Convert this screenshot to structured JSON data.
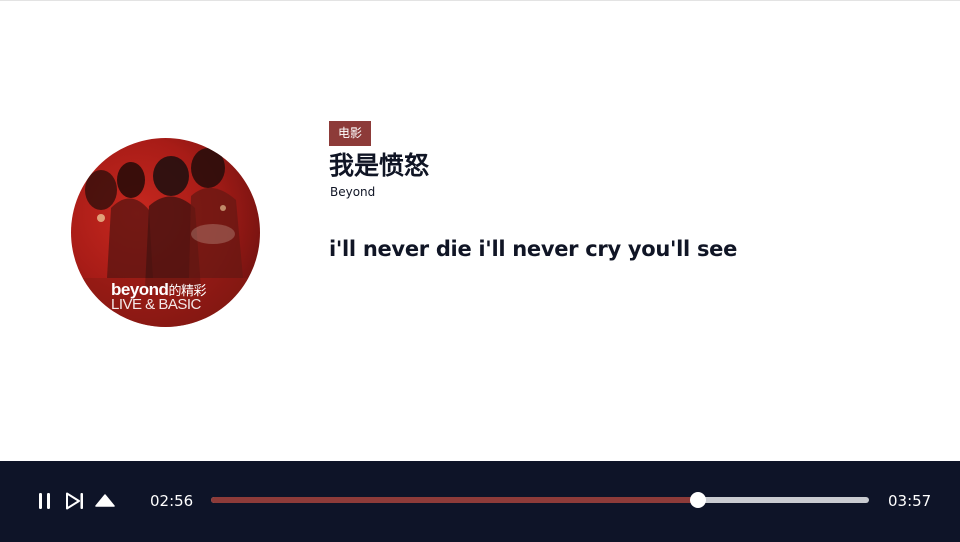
{
  "album": {
    "art_title": "beyond",
    "art_title_cn": "的精彩",
    "art_subtitle": "LIVE & BASIC"
  },
  "track": {
    "tag": "电影",
    "title": "我是愤怒",
    "artist": "Beyond",
    "lyric": "i'll never die i'll never cry you'll see"
  },
  "player": {
    "current_time": "02:56",
    "total_time": "03:57",
    "progress_fraction": 0.74
  },
  "icons": {
    "pause": "pause-icon",
    "next": "next-track-icon",
    "eject": "eject-icon"
  },
  "colors": {
    "accent": "#8d3b39",
    "player_bg": "#0e1428",
    "text_dark": "#101525",
    "track_bg": "#c9cbd1"
  }
}
